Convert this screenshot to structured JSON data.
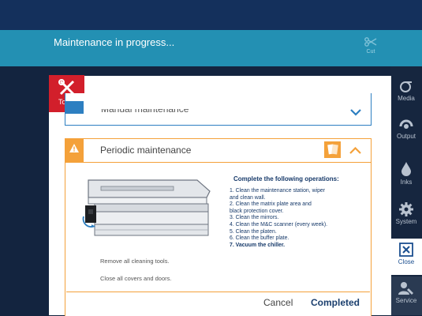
{
  "banner": {
    "title": "Maintenance in progress...",
    "cut_label": "Cut"
  },
  "tools": {
    "label": "Tools"
  },
  "sidebar": {
    "items": [
      {
        "label": "Media",
        "icon": "media-icon"
      },
      {
        "label": "Output",
        "icon": "output-icon"
      },
      {
        "label": "Inks",
        "icon": "ink-drop-icon"
      },
      {
        "label": "System",
        "icon": "gear-icon"
      },
      {
        "label": "Close",
        "icon": "close-icon"
      },
      {
        "label": "Service",
        "icon": "service-icon"
      }
    ]
  },
  "manual": {
    "title": "Manual maintenance"
  },
  "periodic": {
    "title": "Periodic maintenance",
    "operations_title": "Complete the following operations:",
    "operations": [
      "1. Clean the maintenance station, wiper",
      "and clean wall.",
      "2. Clean the matrix plate area and",
      "black protection cover.",
      "3. Clean the mirrors.",
      "4. Clean the M&C scanner (every week).",
      "5. Clean the platen.",
      "6. Clean the buffer plate.",
      "7. Vacuum the chiller."
    ],
    "note_tools": "Remove all cleaning tools.",
    "note_covers": "Close all covers and doors."
  },
  "actions": {
    "cancel": "Cancel",
    "completed": "Completed"
  },
  "colors": {
    "accent_orange": "#f4a13a",
    "accent_blue": "#2d7fc1",
    "tools_red": "#d21f2b",
    "banner_teal": "#2390b3"
  }
}
